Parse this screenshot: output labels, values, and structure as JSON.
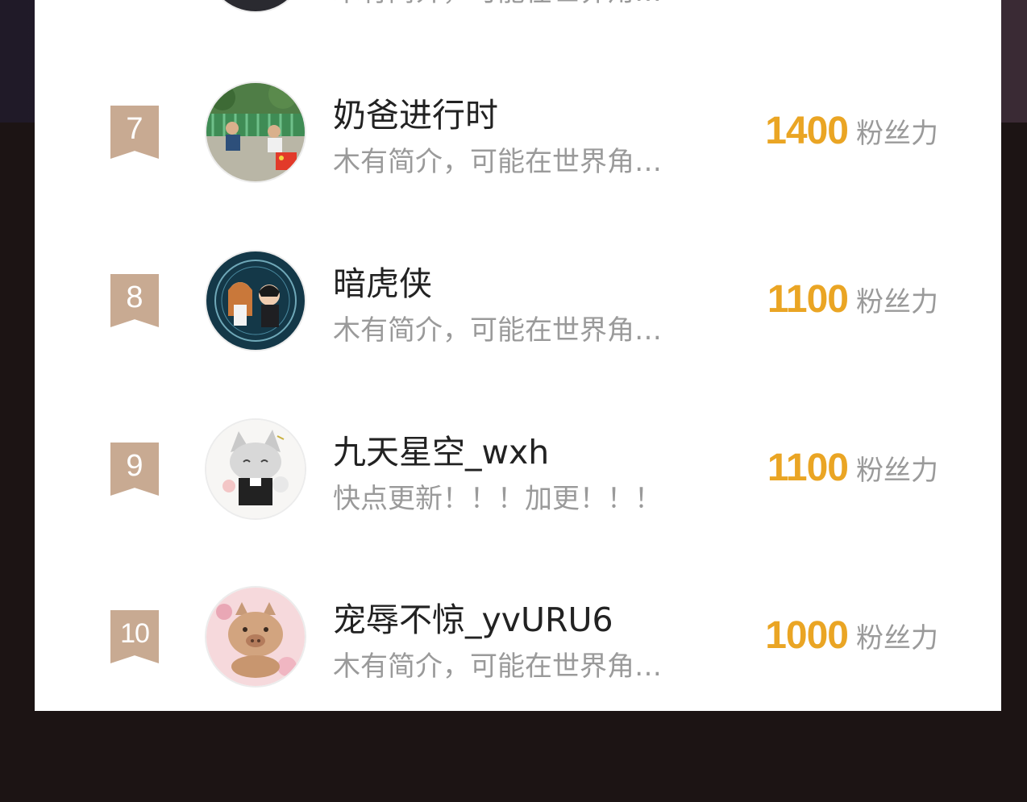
{
  "leaderboard": {
    "partial_bio": "木有简介，可能在世界角…",
    "score_unit": "粉丝力",
    "entries": [
      {
        "rank": "7",
        "name": "奶爸进行时",
        "bio": "木有简介，可能在世界角…",
        "score": "1400",
        "avatar_icon": "avatar-photo-kids-icon"
      },
      {
        "rank": "8",
        "name": "暗虎侠",
        "bio": "木有简介，可能在世界角…",
        "score": "1100",
        "avatar_icon": "avatar-anime-couple-icon"
      },
      {
        "rank": "9",
        "name": "九天星空_wxh",
        "bio": "快点更新！！！加更！！！",
        "score": "1100",
        "avatar_icon": "avatar-cat-girl-icon"
      },
      {
        "rank": "10",
        "name": "宠辱不惊_yvURU6",
        "bio": "木有简介，可能在世界角…",
        "score": "1000",
        "avatar_icon": "avatar-pig-icon"
      }
    ]
  },
  "colors": {
    "badge": "#c8aa92",
    "score": "#eaa524",
    "name": "#222222",
    "bio": "#9a9a9a"
  }
}
